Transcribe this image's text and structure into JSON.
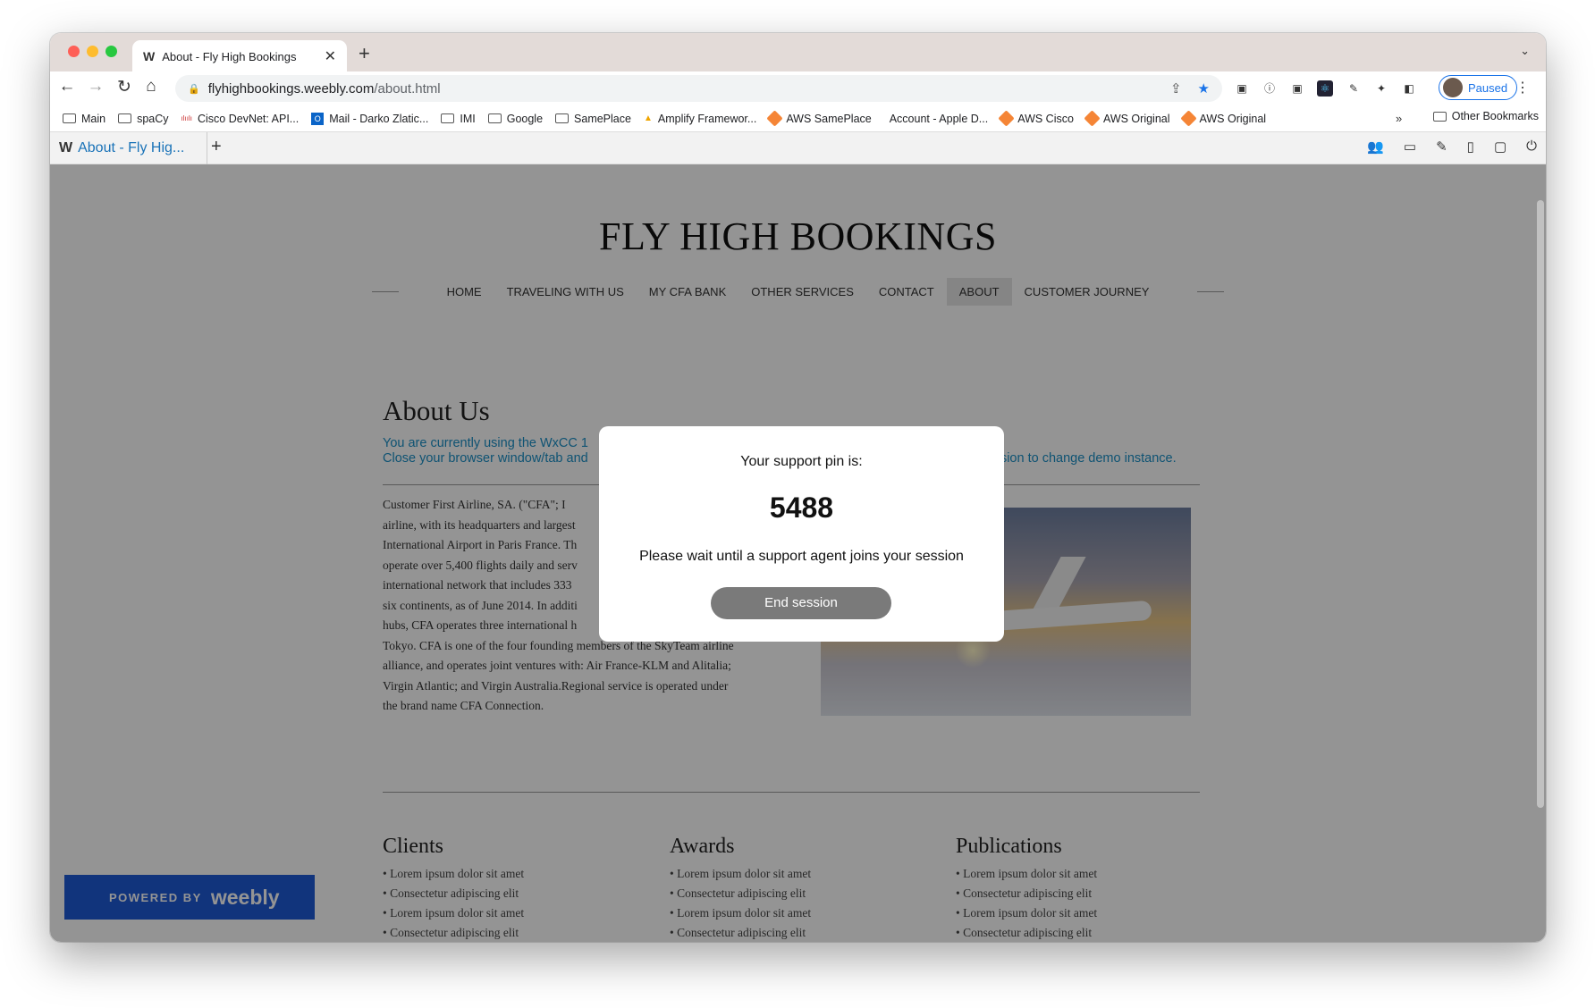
{
  "browser": {
    "tab_title": "About - Fly High Bookings",
    "url_host": "flyhighbookings.weebly.com",
    "url_path": "/about.html",
    "profile_status": "Paused",
    "bookmarks": [
      "Main",
      "spaCy",
      "Cisco DevNet: API...",
      "Mail - Darko Zlatic...",
      "IMI",
      "Google",
      "SamePlace",
      "Amplify Framewor...",
      "AWS SamePlace",
      "Account - Apple D...",
      "AWS Cisco",
      "AWS Original",
      "AWS Original"
    ],
    "other_bookmarks": "Other Bookmarks"
  },
  "inner": {
    "tab_title": "About - Fly Hig..."
  },
  "site": {
    "title": "FLY HIGH BOOKINGS",
    "nav": [
      "HOME",
      "TRAVELING WITH US",
      "MY CFA BANK",
      "OTHER SERVICES",
      "CONTACT",
      "ABOUT",
      "CUSTOMER JOURNEY"
    ],
    "about_heading": "About Us",
    "notice_line1": "You are currently using the WxCC 1",
    "notice_line2_left": "Close your browser window/tab and",
    "notice_line2_right": "ssion to change demo instance.",
    "body": [
      "Customer First Airline, SA. (\"CFA\"; I",
      "airline, with its headquarters and largest",
      "International Airport in Paris France. Th",
      "operate over 5,400 flights daily and serv",
      "international network that includes 333",
      "six continents, as of June 2014. In additi",
      "hubs, CFA operates three international h",
      "Tokyo. CFA is one of the four founding members of the SkyTeam airline",
      "alliance, and operates joint ventures with: Air France-KLM and Alitalia;",
      "Virgin Atlantic; and Virgin Australia.Regional service is operated under",
      "the brand name CFA Connection."
    ],
    "columns": [
      {
        "title": "Clients",
        "items": [
          "• Lorem ipsum dolor sit amet",
          "• Consectetur adipiscing elit",
          "• Lorem ipsum dolor sit amet",
          "• Consectetur adipiscing elit"
        ]
      },
      {
        "title": "Awards",
        "items": [
          "• Lorem ipsum dolor sit amet",
          "• Consectetur adipiscing elit",
          "• Lorem ipsum dolor sit amet",
          "• Consectetur adipiscing elit"
        ]
      },
      {
        "title": "Publications",
        "items": [
          "• Lorem ipsum dolor sit amet",
          "• Consectetur adipiscing elit",
          "• Lorem ipsum dolor sit amet",
          "• Consectetur adipiscing elit"
        ]
      }
    ],
    "badge_powered": "POWERED BY",
    "badge_brand": "weebly"
  },
  "modal": {
    "line1": "Your support pin is:",
    "pin": "5488",
    "line2": "Please wait until a support agent joins your session",
    "button": "End session"
  }
}
